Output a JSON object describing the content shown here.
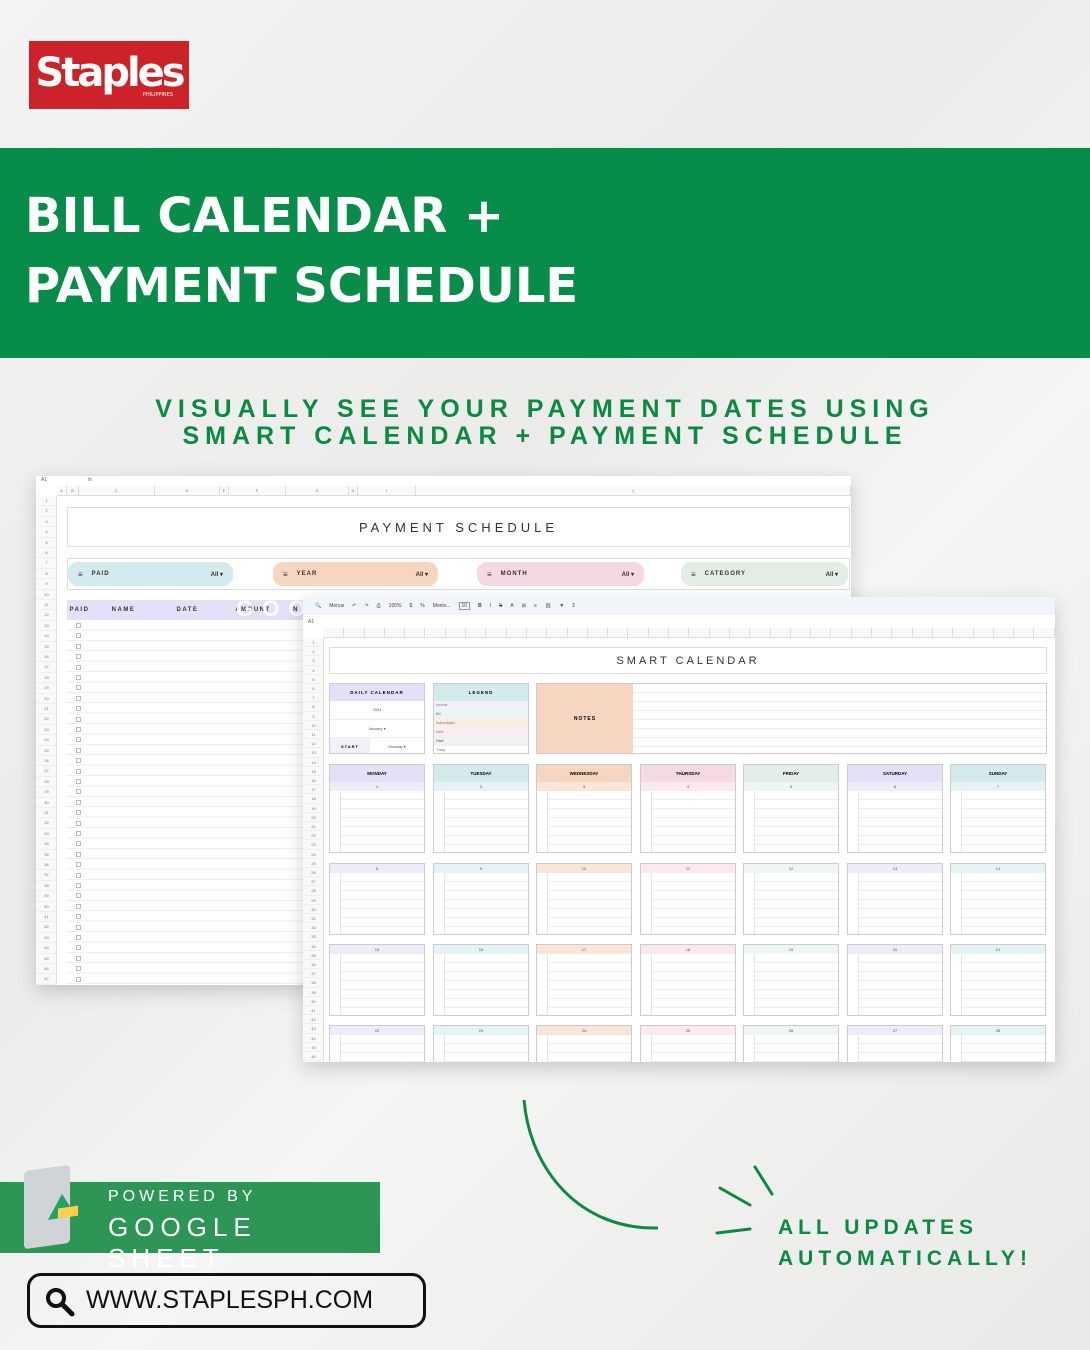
{
  "logo": {
    "text": "Staples",
    "sub": "PHILIPPINES",
    "color": "#cc2229"
  },
  "banner": {
    "line1": "BILL CALENDAR +",
    "line2": "PAYMENT SCHEDULE",
    "color": "#088c4a"
  },
  "subtitle": {
    "line1": "VISUALLY SEE YOUR PAYMENT DATES USING",
    "line2": "SMART CALENDAR + PAYMENT SCHEDULE"
  },
  "payment_sheet": {
    "cell_ref": "A1",
    "fx": "fx",
    "columns": [
      "A",
      "B",
      "C",
      "D",
      "E",
      "F",
      "G",
      "H",
      "I",
      "J"
    ],
    "title": "PAYMENT SCHEDULE",
    "filters": [
      {
        "label": "PAID",
        "value": "All ▾",
        "color": "#d3eaee"
      },
      {
        "label": "YEAR",
        "value": "All ▾",
        "color": "#f6d6c0"
      },
      {
        "label": "MONTH",
        "value": "All ▾",
        "color": "#f5d9e2"
      },
      {
        "label": "CATEGORY",
        "value": "All ▾",
        "color": "#e2ede6"
      }
    ],
    "headers": [
      "PAID",
      "NAME",
      "DATE",
      "AMOUNT",
      "N"
    ],
    "watermark": "GOOGLE SHEETS"
  },
  "calendar_sheet": {
    "cell_ref": "A1",
    "menu_search": "Menus",
    "zoom": "100%",
    "font_size": "10",
    "font": "Monts...",
    "title": "SMART CALENDAR",
    "daily": {
      "label": "DAILY CALENDAR",
      "year": "2024",
      "month": "January",
      "start_label": "START",
      "start_value": "Monday"
    },
    "legend": {
      "label": "LEGEND",
      "items": [
        "Income",
        "Bill",
        "Subscription",
        "Debt",
        "Paid",
        "Today"
      ]
    },
    "notes_label": "NOTES",
    "weekdays": [
      "MONDAY",
      "TUESDAY",
      "WEDNESDAY",
      "THURSDAY",
      "FRIDAY",
      "SATURDAY",
      "SUNDAY"
    ],
    "day_colors": [
      "#e4e0f7",
      "#d4ebee",
      "#f6d6c0",
      "#f6dbe3",
      "#e4eee8",
      "#e4e0f7",
      "#d4ebee"
    ],
    "weeks": [
      [
        "1",
        "2",
        "3",
        "4",
        "5",
        "6",
        "7"
      ],
      [
        "8",
        "9",
        "10",
        "11",
        "12",
        "13",
        "14"
      ],
      [
        "15",
        "16",
        "17",
        "18",
        "19",
        "20",
        "21"
      ],
      [
        "22",
        "23",
        "24",
        "25",
        "26",
        "27",
        "28"
      ]
    ]
  },
  "powered": {
    "line1": "POWERED BY",
    "line2": "GOOGLE SHEET"
  },
  "url": "WWW.STAPLESPH.COM",
  "updates": {
    "line1": "ALL UPDATES",
    "line2": "AUTOMATICALLY!"
  }
}
